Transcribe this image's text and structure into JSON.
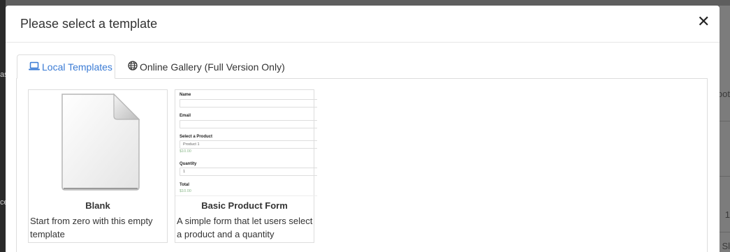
{
  "modal": {
    "title": "Please select a template",
    "close_symbol": "✕"
  },
  "tabs": [
    {
      "label": "Local Templates",
      "icon": "laptop-icon",
      "active": true
    },
    {
      "label": "Online Gallery (Full Version Only)",
      "icon": "globe-icon",
      "active": false
    }
  ],
  "templates": [
    {
      "name": "Blank",
      "description": "Start from zero with this empty template",
      "thumbnail": "blank-page-icon"
    },
    {
      "name": "Basic Product Form",
      "description": "A simple form that let users select a product and a quantity",
      "preview": {
        "name_label": "Name",
        "email_label": "Email",
        "product_label": "Select a Product",
        "product_value": "Product 1",
        "product_price": "$10.00",
        "quantity_label": "Quantity",
        "quantity_value": "1",
        "total_label": "Total",
        "total_value": "$10.00"
      }
    }
  ],
  "background": {
    "left_text_1": "as",
    "left_text_2": "ce",
    "right_text_1": "oot",
    "right_text_2": "1",
    "right_text_3": "Sl"
  },
  "colors": {
    "accent": "#3a7bd5",
    "border": "#dddddd",
    "price_green": "#8ab88a"
  }
}
